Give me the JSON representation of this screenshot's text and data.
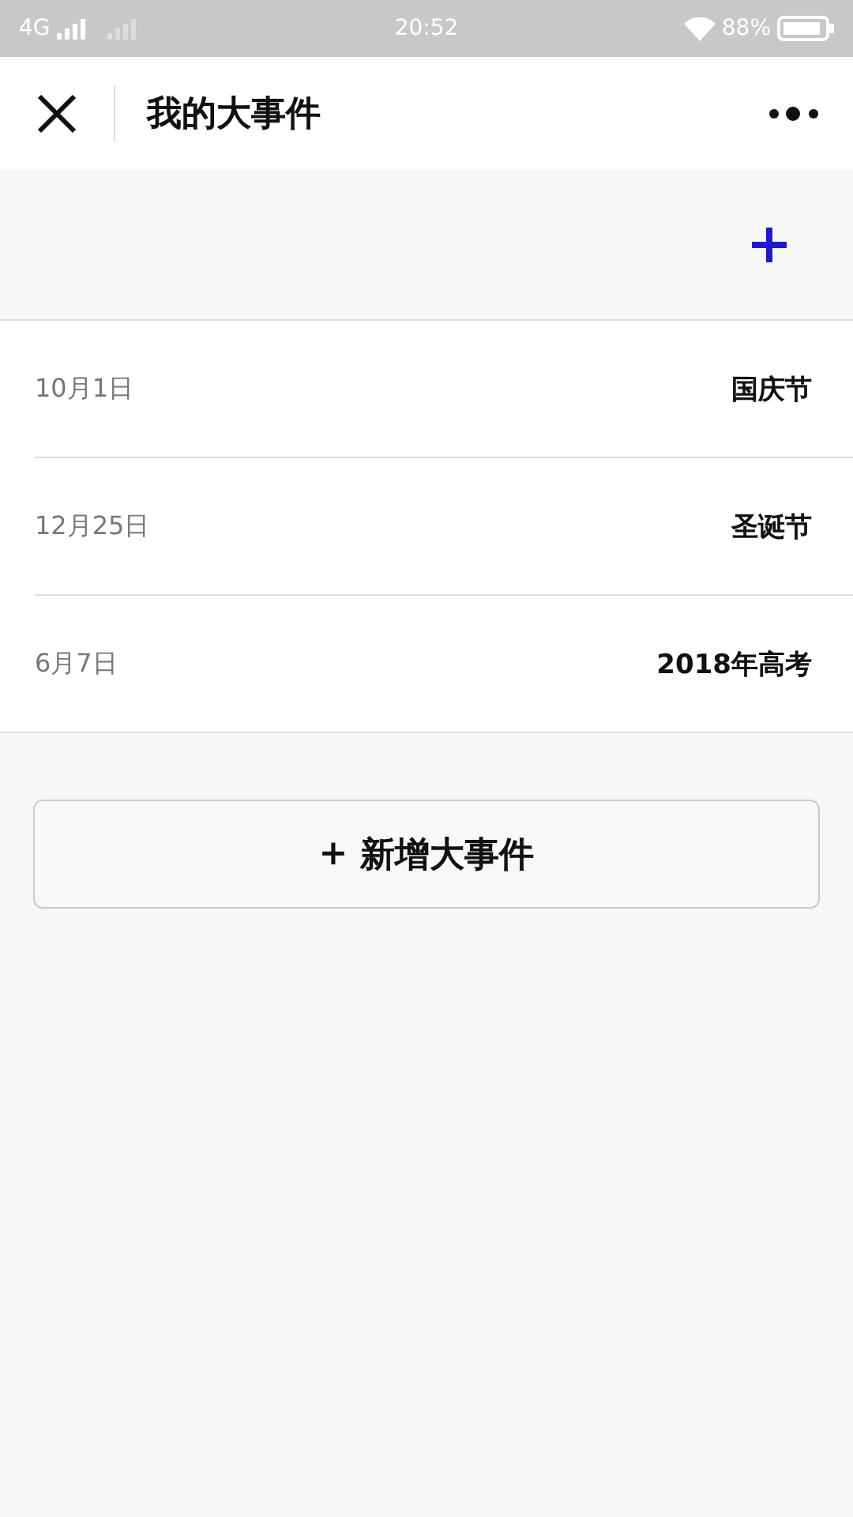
{
  "status_bar": {
    "network": "4G",
    "time": "20:52",
    "battery": "88%"
  },
  "nav_bar": {
    "title": "我的大事件"
  },
  "events": [
    {
      "date": "10月1日",
      "name": "国庆节"
    },
    {
      "date": "12月25日",
      "name": "圣诞节"
    },
    {
      "date": "6月7日",
      "name": "2018年高考"
    }
  ],
  "add_button": {
    "icon": "+",
    "label": "新增大事件"
  }
}
